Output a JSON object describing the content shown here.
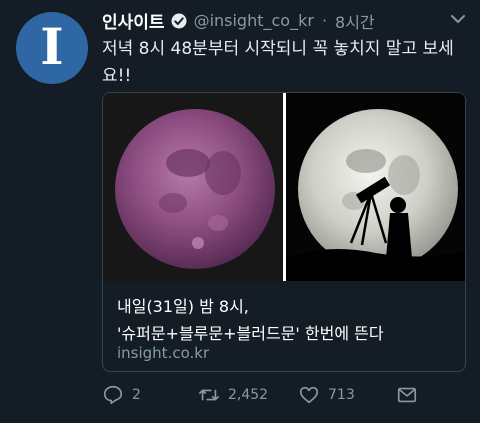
{
  "tweet": {
    "avatar_letter": "I",
    "display_name": "인사이트",
    "handle": "@insight_co_kr",
    "separator": "·",
    "time": "8시간",
    "text": "저녁 8시 48분부터 시작되니 꼭 놓치지 말고 보세요!!"
  },
  "card": {
    "title": "내일(31일) 밤 8시,",
    "subtitle": "'슈퍼문+블루문+블러드문' 한번에 뜬다",
    "domain": "insight.co.kr"
  },
  "actions": {
    "reply_count": "2",
    "retweet_count": "2,452",
    "like_count": "713"
  },
  "colors": {
    "background": "#141d26",
    "accent_avatar": "#2f67a4",
    "muted_text": "#8899a6",
    "border": "#38444d"
  },
  "icons": [
    "verified-icon",
    "chevron-down-icon",
    "reply-icon",
    "retweet-icon",
    "like-icon",
    "message-icon"
  ]
}
